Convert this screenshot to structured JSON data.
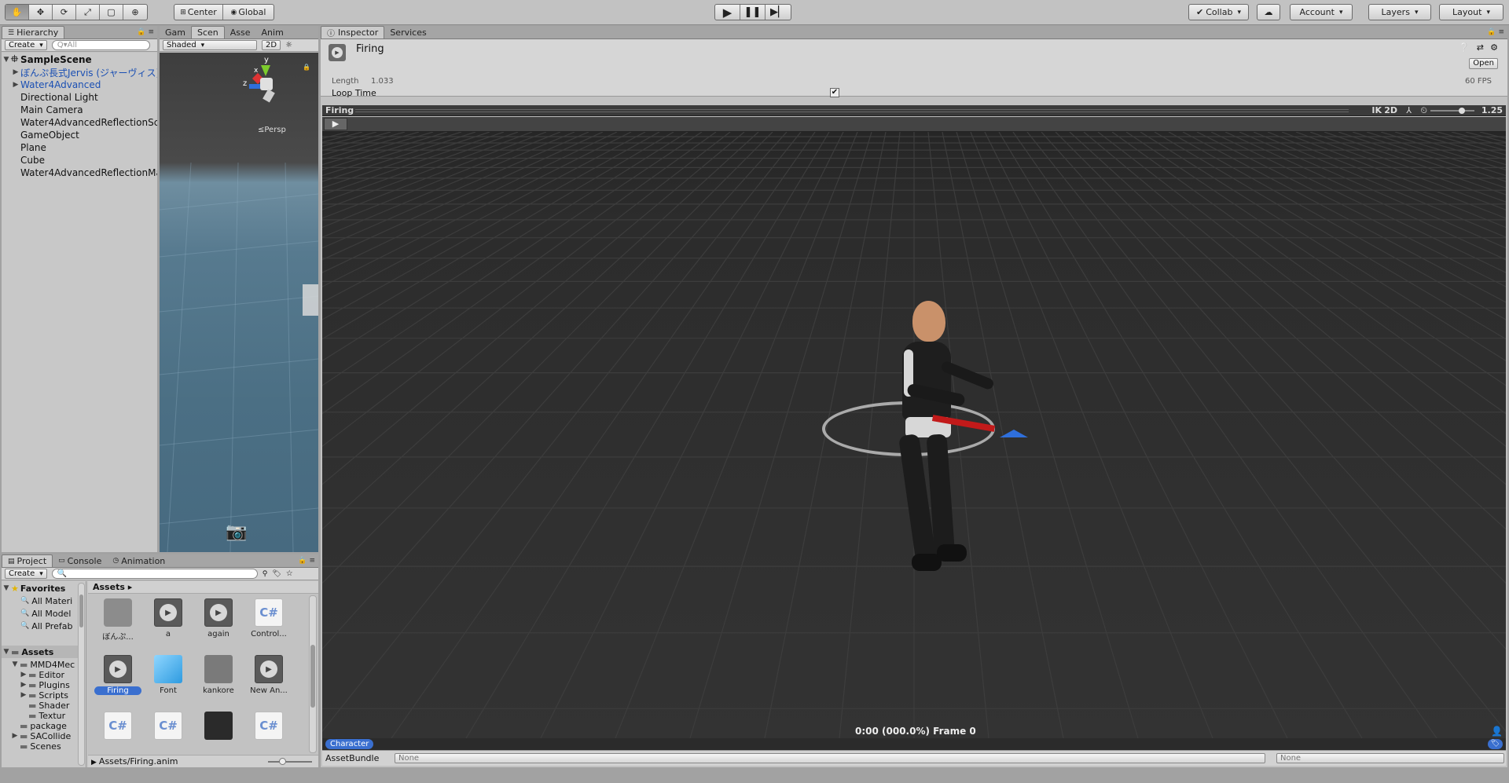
{
  "toolbar": {
    "tools": [
      "hand-icon",
      "move-icon",
      "rotate-icon",
      "scale-icon",
      "rect-icon",
      "transform-icon"
    ],
    "pivot": "Center",
    "space": "Global",
    "collab": "Collab",
    "account": "Account",
    "layers": "Layers",
    "layout": "Layout"
  },
  "hierarchy": {
    "tab": "Hierarchy",
    "create": "Create",
    "search_placeholder": "Q▾All",
    "scene": "SampleScene",
    "items": [
      {
        "label": "ぼんぷ長式Jervis (ジャーヴィス)",
        "prefab": true,
        "expandable": true
      },
      {
        "label": "Water4Advanced",
        "prefab": true,
        "expandable": true
      },
      {
        "label": "Directional Light",
        "prefab": false,
        "expandable": false
      },
      {
        "label": "Main Camera",
        "prefab": false,
        "expandable": false
      },
      {
        "label": "Water4AdvancedReflectionSc",
        "prefab": false,
        "expandable": false
      },
      {
        "label": "GameObject",
        "prefab": false,
        "expandable": false
      },
      {
        "label": "Plane",
        "prefab": false,
        "expandable": false
      },
      {
        "label": "Cube",
        "prefab": false,
        "expandable": false
      },
      {
        "label": "Water4AdvancedReflectionMa",
        "prefab": false,
        "expandable": false
      }
    ]
  },
  "scene_panel": {
    "tabs": [
      "Gam",
      "Scen",
      "Asse",
      "Anim"
    ],
    "active_tab": "Scen",
    "shading": "Shaded",
    "mode_2d": "2D",
    "gizmo_y": "y",
    "gizmo_x": "x",
    "gizmo_z": "z",
    "persp": "≤Persp"
  },
  "inspector": {
    "tabs": [
      "Inspector",
      "Services"
    ],
    "clip_name": "Firing",
    "open": "Open",
    "length_label": "Length",
    "length_value": "1.033",
    "fps": "60 FPS",
    "loop_time_label": "Loop Time",
    "loop_time": true
  },
  "preview": {
    "clip": "Firing",
    "ik": "IK",
    "mode_2d": "2D",
    "speed": "1.25",
    "time_readout": "0:00 (000.0%) Frame 0",
    "avatar_label": "Character"
  },
  "assetbundle": {
    "label": "AssetBundle",
    "name": "None",
    "variant": "None"
  },
  "project": {
    "tabs": [
      "Project",
      "Console",
      "Animation"
    ],
    "create": "Create",
    "favorites_label": "Favorites",
    "favorites": [
      "All Materi",
      "All Model",
      "All Prefab"
    ],
    "assets_label": "Assets",
    "tree": [
      {
        "label": "MMD4Mec",
        "depth": 1,
        "expandable": true
      },
      {
        "label": "Editor",
        "depth": 2,
        "expandable": true
      },
      {
        "label": "Plugins",
        "depth": 2,
        "expandable": true
      },
      {
        "label": "Scripts",
        "depth": 2,
        "expandable": true
      },
      {
        "label": "Shader",
        "depth": 2,
        "expandable": false
      },
      {
        "label": "Textur",
        "depth": 2,
        "expandable": false
      },
      {
        "label": "package",
        "depth": 1,
        "expandable": false
      },
      {
        "label": "SACollide",
        "depth": 1,
        "expandable": true
      },
      {
        "label": "Scenes",
        "depth": 1,
        "expandable": false
      }
    ],
    "breadcrumb": "Assets ▸",
    "grid": [
      {
        "label": "ぼんぷ...",
        "type": "folder"
      },
      {
        "label": "a",
        "type": "anim"
      },
      {
        "label": "again",
        "type": "anim"
      },
      {
        "label": "Control...",
        "type": "script"
      },
      {
        "label": "Firing",
        "type": "anim",
        "selected": true
      },
      {
        "label": "Font",
        "type": "cube"
      },
      {
        "label": "kankore",
        "type": "sprite"
      },
      {
        "label": "New An...",
        "type": "anim"
      },
      {
        "label": "",
        "type": "script"
      },
      {
        "label": "",
        "type": "script"
      },
      {
        "label": "",
        "type": "dark"
      },
      {
        "label": "",
        "type": "script"
      }
    ],
    "status_path": "Assets/Firing.anim"
  }
}
